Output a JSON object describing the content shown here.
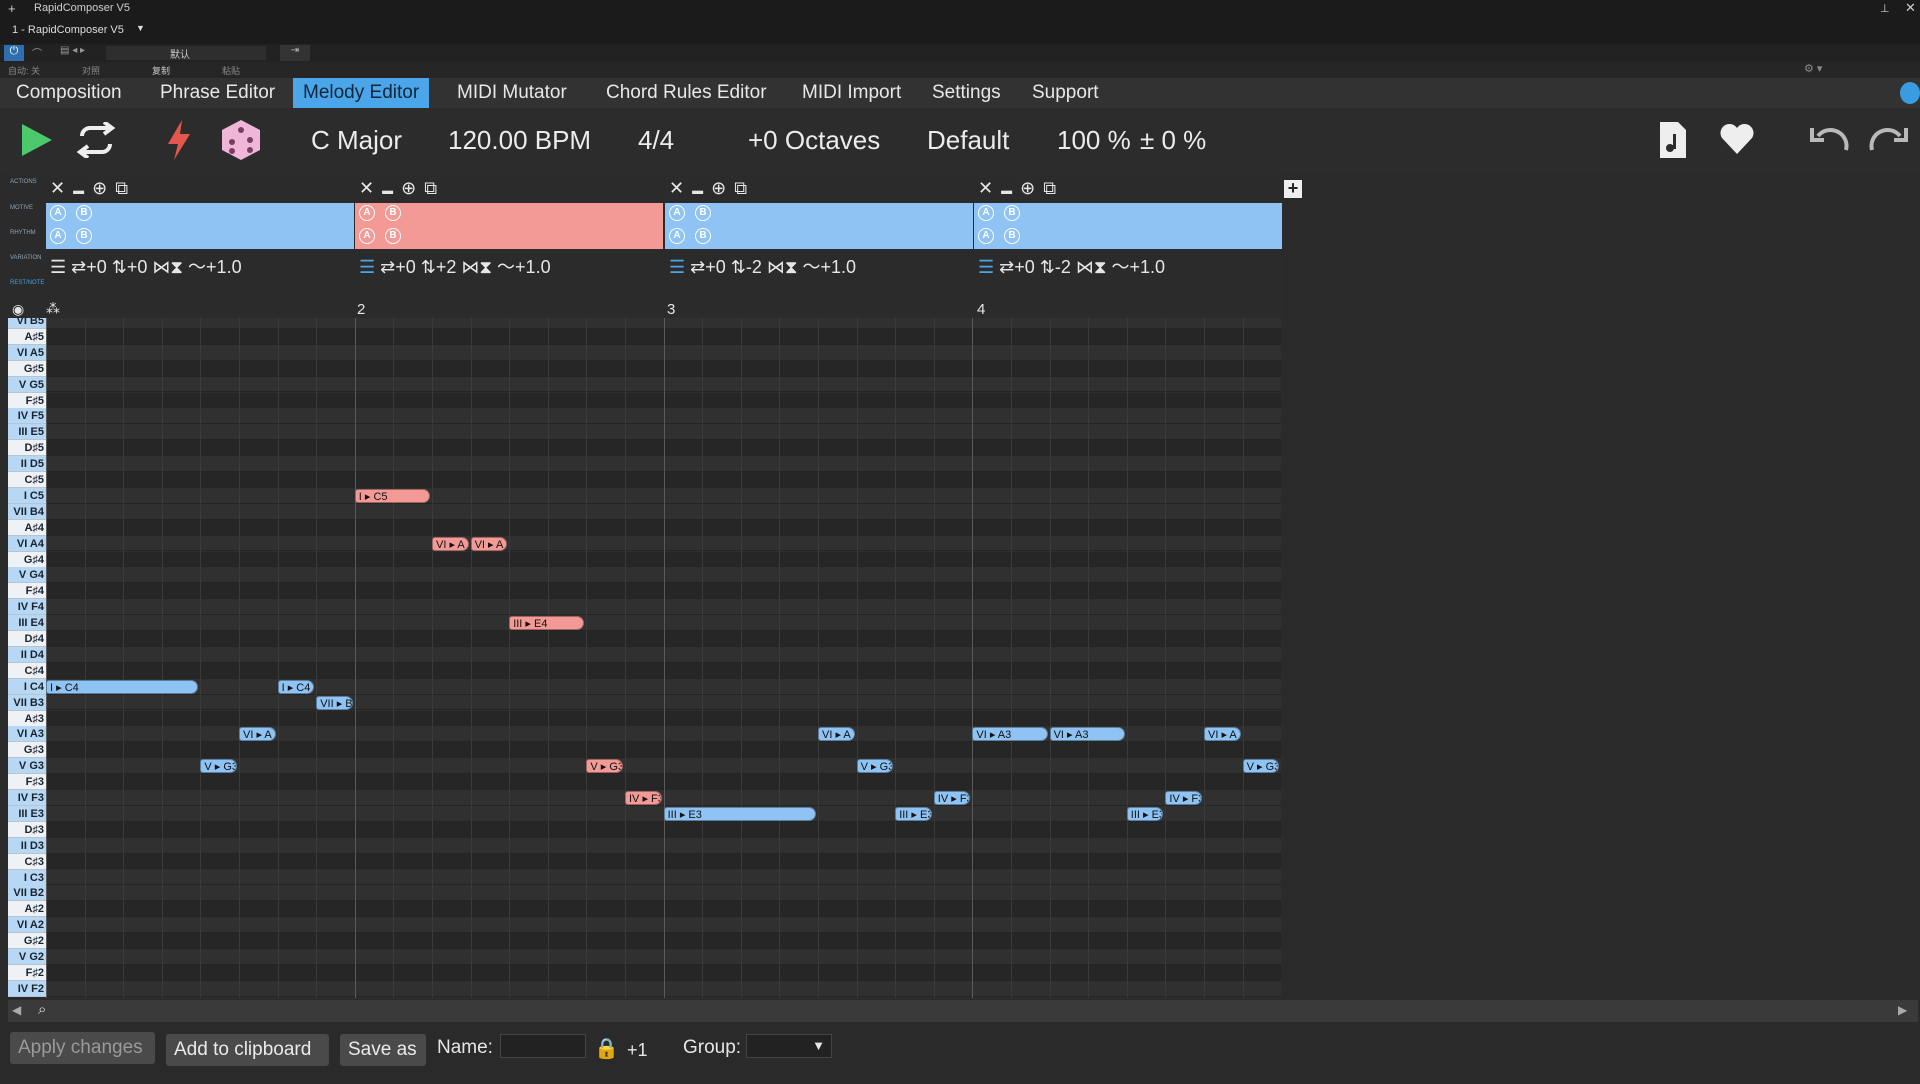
{
  "host": {
    "window_title": "RapidComposer V5",
    "instance": "1 - RapidComposer V5",
    "preset": "默认",
    "auto": "自动: 关",
    "compare": "对照",
    "copy": "复制",
    "paste": "粘贴"
  },
  "menu": [
    "Composition",
    "Phrase Editor",
    "Melody Editor",
    "MIDI Mutator",
    "Chord Rules Editor",
    "MIDI Import",
    "Settings",
    "Support"
  ],
  "active_menu": "Melody Editor",
  "toolbar": {
    "key": "C Major",
    "tempo": "120.00 BPM",
    "meter": "4/4",
    "octaves": "+0 Octaves",
    "preset": "Default",
    "velocity": "100 %",
    "humanize": "± 0 %"
  },
  "lane_labels": {
    "actions": "ACTIONS",
    "motive": "MOTIVE",
    "rhythm": "RHYTHM",
    "variation": "VARIATION",
    "restinote": "REST/NOTE"
  },
  "segments": [
    {
      "color": "blue",
      "var": [
        "+0",
        "+0",
        "+1.0"
      ]
    },
    {
      "color": "red",
      "var": [
        "+0",
        "+2",
        "+1.0"
      ]
    },
    {
      "color": "blue",
      "var": [
        "+0",
        "-2",
        "+1.0"
      ]
    },
    {
      "color": "blue",
      "var": [
        "+0",
        "-2",
        "+1.0"
      ]
    }
  ],
  "ab": {
    "a": "A",
    "b": "B"
  },
  "bars": [
    "2",
    "3",
    "4"
  ],
  "keys": [
    "VI B5",
    "A♯5",
    "VI A5",
    "G♯5",
    "V G5",
    "F♯5",
    "IV F5",
    "III E5",
    "D♯5",
    "II D5",
    "C♯5",
    "I C5",
    "VII B4",
    "A♯4",
    "VI A4",
    "G♯4",
    "V G4",
    "F♯4",
    "IV F4",
    "III E4",
    "D♯4",
    "II D4",
    "C♯4",
    "I C4",
    "VII B3",
    "A♯3",
    "VI A3",
    "G♯3",
    "V G3",
    "F♯3",
    "IV F3",
    "III E3",
    "D♯3",
    "II D3",
    "C♯3",
    "I C3",
    "VII B2",
    "A♯2",
    "VI A2",
    "G♯2",
    "V G2",
    "F♯2",
    "IV F2"
  ],
  "notes": [
    {
      "label": "I ▸ C4",
      "color": "blue",
      "start": 0,
      "len": 2
    },
    {
      "label": "V ▸ G3",
      "color": "blue",
      "start": 2,
      "len": 0.5
    },
    {
      "label": "VI ▸ A",
      "color": "blue",
      "start": 2.5,
      "len": 0.5
    },
    {
      "label": "I ▸ C4",
      "color": "blue",
      "start": 3,
      "len": 0.5
    },
    {
      "label": "VII ▸ B",
      "color": "blue",
      "start": 3.5,
      "len": 0.5
    },
    {
      "label": "I ▸ C5",
      "color": "red",
      "start": 4,
      "len": 1
    },
    {
      "label": "VI ▸ A",
      "color": "red",
      "start": 5,
      "len": 0.5
    },
    {
      "label": "VI ▸ A",
      "color": "red",
      "start": 5.5,
      "len": 0.5
    },
    {
      "label": "III ▸ E4",
      "color": "red",
      "start": 6,
      "len": 1
    },
    {
      "label": "V ▸ G3",
      "color": "red",
      "start": 7,
      "len": 0.5
    },
    {
      "label": "IV ▸ F3",
      "color": "red",
      "start": 7.5,
      "len": 0.5
    },
    {
      "label": "III ▸ E3",
      "color": "blue",
      "start": 8,
      "len": 2
    },
    {
      "label": "VI ▸ A",
      "color": "blue",
      "start": 10,
      "len": 0.5
    },
    {
      "label": "V ▸ G3",
      "color": "blue",
      "start": 10.5,
      "len": 0.5
    },
    {
      "label": "III ▸ E3",
      "color": "blue",
      "start": 11,
      "len": 0.5
    },
    {
      "label": "IV ▸ F3",
      "color": "blue",
      "start": 11.5,
      "len": 0.5
    },
    {
      "label": "VI ▸ A3",
      "color": "blue",
      "start": 12,
      "len": 1
    },
    {
      "label": "VI ▸ A3",
      "color": "blue",
      "start": 13,
      "len": 1
    },
    {
      "label": "III ▸ E3",
      "color": "blue",
      "start": 14,
      "len": 0.5
    },
    {
      "label": "IV ▸ F3",
      "color": "blue",
      "start": 14.5,
      "len": 0.5
    },
    {
      "label": "VI ▸ A",
      "color": "blue",
      "start": 15,
      "len": 0.5
    },
    {
      "label": "V ▸ G3",
      "color": "blue",
      "start": 15.5,
      "len": 0.5
    }
  ],
  "bottom": {
    "apply": "Apply changes",
    "clipboard": "Add to clipboard",
    "saveas": "Save as",
    "name_label": "Name:",
    "plus_one": "+1",
    "group_label": "Group:"
  }
}
